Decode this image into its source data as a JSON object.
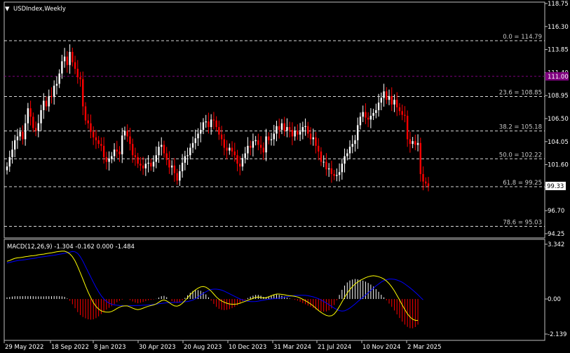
{
  "chart_data": [
    {
      "type": "candlestick",
      "title": "USDIndex,Weekly",
      "colors": {
        "up": "#ffffff",
        "down": "#ff0000",
        "grid": "#ffffff",
        "fib": "#ffffff",
        "marker": "#800080",
        "background": "#000000"
      },
      "ylim": [
        93.8,
        118.9
      ],
      "y_ticks": [
        "118.75",
        "116.30",
        "113.85",
        "111.40",
        "108.95",
        "106.50",
        "104.05",
        "101.60",
        "99.15",
        "96.70",
        "94.25"
      ],
      "x_ticks": [
        "29 May 2022",
        "18 Sep 2022",
        "8 Jan 2023",
        "30 Apr 2023",
        "20 Aug 2023",
        "10 Dec 2023",
        "31 Mar 2024",
        "21 Jul 2024",
        "10 Nov 2024",
        "2 Mar 2025"
      ],
      "current_price": "99.33",
      "marker_level": "111.00",
      "fib_levels": [
        {
          "label": "0.0 = 114.79",
          "value": 114.79
        },
        {
          "label": "23.6 = 108.85",
          "value": 108.85
        },
        {
          "label": "38.2 = 105.18",
          "value": 105.18
        },
        {
          "label": "50.0 = 102.22",
          "value": 102.22
        },
        {
          "label": "61.8 = 99.25",
          "value": 99.25
        },
        {
          "label": "78.6 = 95.03",
          "value": 95.03
        }
      ],
      "close": [
        101.4,
        102.4,
        103.2,
        104.2,
        104.6,
        105.1,
        104.3,
        106.0,
        107.6,
        106.7,
        105.5,
        105.2,
        106.0,
        107.4,
        108.4,
        107.8,
        108.9,
        108.8,
        110.0,
        110.2,
        111.3,
        112.6,
        113.1,
        112.2,
        113.6,
        112.5,
        111.8,
        110.9,
        110.7,
        107.8,
        106.3,
        106.0,
        105.1,
        104.5,
        104.2,
        103.8,
        103.6,
        102.4,
        101.9,
        102.2,
        102.5,
        103.2,
        103.0,
        102.7,
        104.7,
        105.2,
        104.6,
        103.8,
        102.6,
        102.4,
        101.7,
        101.5,
        101.2,
        101.7,
        101.8,
        101.4,
        101.9,
        102.6,
        103.5,
        103.7,
        102.8,
        102.1,
        101.3,
        101.5,
        100.7,
        99.9,
        100.9,
        101.8,
        102.5,
        102.6,
        103.4,
        103.9,
        104.4,
        104.9,
        105.3,
        106.1,
        106.2,
        105.6,
        106.4,
        106.3,
        105.6,
        104.8,
        104.3,
        103.4,
        103.1,
        103.4,
        103.0,
        102.6,
        101.7,
        101.4,
        102.3,
        102.8,
        103.6,
        103.4,
        104.1,
        104.2,
        103.7,
        103.4,
        102.9,
        104.6,
        104.2,
        104.3,
        104.9,
        105.7,
        105.3,
        106.0,
        105.2,
        105.6,
        105.3,
        104.6,
        105.2,
        104.8,
        105.1,
        105.6,
        105.7,
        104.9,
        104.3,
        104.5,
        103.6,
        103.0,
        101.9,
        101.9,
        101.1,
        101.2,
        100.6,
        100.4,
        100.5,
        100.8,
        101.7,
        102.5,
        102.8,
        103.5,
        103.8,
        104.2,
        105.8,
        106.7,
        107.2,
        106.6,
        106.4,
        106.8,
        107.1,
        107.4,
        108.2,
        108.7,
        109.4,
        108.5,
        108.9,
        108.0,
        108.5,
        107.7,
        107.3,
        106.9,
        106.8,
        104.3,
        103.8,
        104.1,
        103.7,
        103.9,
        100.6,
        99.8,
        99.6,
        99.33
      ],
      "macd": {
        "label": "MACD(12,26,9) -1.304 -0.162 0.000 -1.484",
        "ylim": [
          -2.139,
          3.342
        ],
        "y_ticks": [
          "3.342",
          "0.00",
          "-2.139"
        ],
        "signal": [
          2.2,
          2.23,
          2.27,
          2.31,
          2.34,
          2.36,
          2.38,
          2.4,
          2.43,
          2.45,
          2.47,
          2.5,
          2.54,
          2.56,
          2.58,
          2.6,
          2.63,
          2.65,
          2.67,
          2.7,
          2.73,
          2.76,
          2.79,
          2.83,
          2.86,
          2.9,
          2.88,
          2.78,
          2.58,
          2.3,
          1.98,
          1.66,
          1.34,
          1.02,
          0.72,
          0.44,
          0.2,
          0.0,
          -0.15,
          -0.26,
          -0.32,
          -0.36,
          -0.38,
          -0.39,
          -0.4,
          -0.42,
          -0.42,
          -0.41,
          -0.41,
          -0.4,
          -0.39,
          -0.39,
          -0.38,
          -0.37,
          -0.36,
          -0.35,
          -0.33,
          -0.31,
          -0.29,
          -0.27,
          -0.25,
          -0.23,
          -0.22,
          -0.21,
          -0.2,
          -0.2,
          -0.19,
          -0.18,
          -0.17,
          -0.15,
          -0.12,
          -0.07,
          0.02,
          0.12,
          0.24,
          0.34,
          0.44,
          0.52,
          0.58,
          0.6,
          0.6,
          0.58,
          0.54,
          0.48,
          0.4,
          0.32,
          0.24,
          0.16,
          0.08,
          0.0,
          -0.06,
          -0.1,
          -0.14,
          -0.16,
          -0.16,
          -0.15,
          -0.13,
          -0.1,
          -0.07,
          -0.04,
          -0.02,
          0.0,
          0.02,
          0.03,
          0.05,
          0.08,
          0.11,
          0.14,
          0.17,
          0.19,
          0.21,
          0.22,
          0.23,
          0.23,
          0.22,
          0.2,
          0.17,
          0.13,
          0.08,
          0.02,
          -0.06,
          -0.15,
          -0.24,
          -0.35,
          -0.45,
          -0.55,
          -0.64,
          -0.71,
          -0.74,
          -0.72,
          -0.65,
          -0.55,
          -0.43,
          -0.3,
          -0.16,
          -0.03,
          0.1,
          0.24,
          0.38,
          0.52,
          0.66,
          0.8,
          0.92,
          1.04,
          1.12,
          1.18,
          1.22,
          1.22,
          1.2,
          1.16,
          1.1,
          1.02,
          0.92,
          0.8,
          0.68,
          0.55,
          0.41,
          0.26,
          0.1,
          -0.05
        ],
        "macd_line": [
          2.3,
          2.35,
          2.42,
          2.48,
          2.51,
          2.53,
          2.55,
          2.58,
          2.6,
          2.63,
          2.64,
          2.66,
          2.7,
          2.72,
          2.74,
          2.77,
          2.8,
          2.82,
          2.85,
          2.88,
          2.9,
          2.92,
          2.92,
          2.86,
          2.75,
          2.58,
          2.32,
          1.98,
          1.6,
          1.2,
          0.8,
          0.42,
          0.08,
          -0.22,
          -0.45,
          -0.62,
          -0.72,
          -0.78,
          -0.8,
          -0.8,
          -0.76,
          -0.68,
          -0.58,
          -0.5,
          -0.44,
          -0.42,
          -0.42,
          -0.48,
          -0.56,
          -0.62,
          -0.65,
          -0.62,
          -0.56,
          -0.5,
          -0.44,
          -0.4,
          -0.36,
          -0.3,
          -0.2,
          -0.1,
          -0.06,
          -0.12,
          -0.22,
          -0.34,
          -0.42,
          -0.44,
          -0.38,
          -0.26,
          -0.1,
          0.08,
          0.26,
          0.42,
          0.56,
          0.66,
          0.74,
          0.76,
          0.72,
          0.62,
          0.48,
          0.3,
          0.12,
          -0.02,
          -0.12,
          -0.2,
          -0.26,
          -0.3,
          -0.32,
          -0.32,
          -0.3,
          -0.26,
          -0.2,
          -0.14,
          -0.08,
          -0.02,
          0.04,
          0.1,
          0.12,
          0.1,
          0.06,
          0.08,
          0.14,
          0.2,
          0.26,
          0.3,
          0.3,
          0.28,
          0.26,
          0.22,
          0.2,
          0.18,
          0.16,
          0.12,
          0.06,
          -0.02,
          -0.1,
          -0.2,
          -0.3,
          -0.42,
          -0.56,
          -0.7,
          -0.82,
          -0.92,
          -1.0,
          -1.04,
          -1.02,
          -0.92,
          -0.72,
          -0.46,
          -0.18,
          0.1,
          0.36,
          0.58,
          0.76,
          0.92,
          1.04,
          1.14,
          1.22,
          1.3,
          1.36,
          1.4,
          1.42,
          1.4,
          1.36,
          1.3,
          1.22,
          1.1,
          0.94,
          0.74,
          0.5,
          0.22,
          -0.06,
          -0.36,
          -0.64,
          -0.9,
          -1.1,
          -1.24,
          -1.3,
          -1.304
        ]
      }
    }
  ]
}
